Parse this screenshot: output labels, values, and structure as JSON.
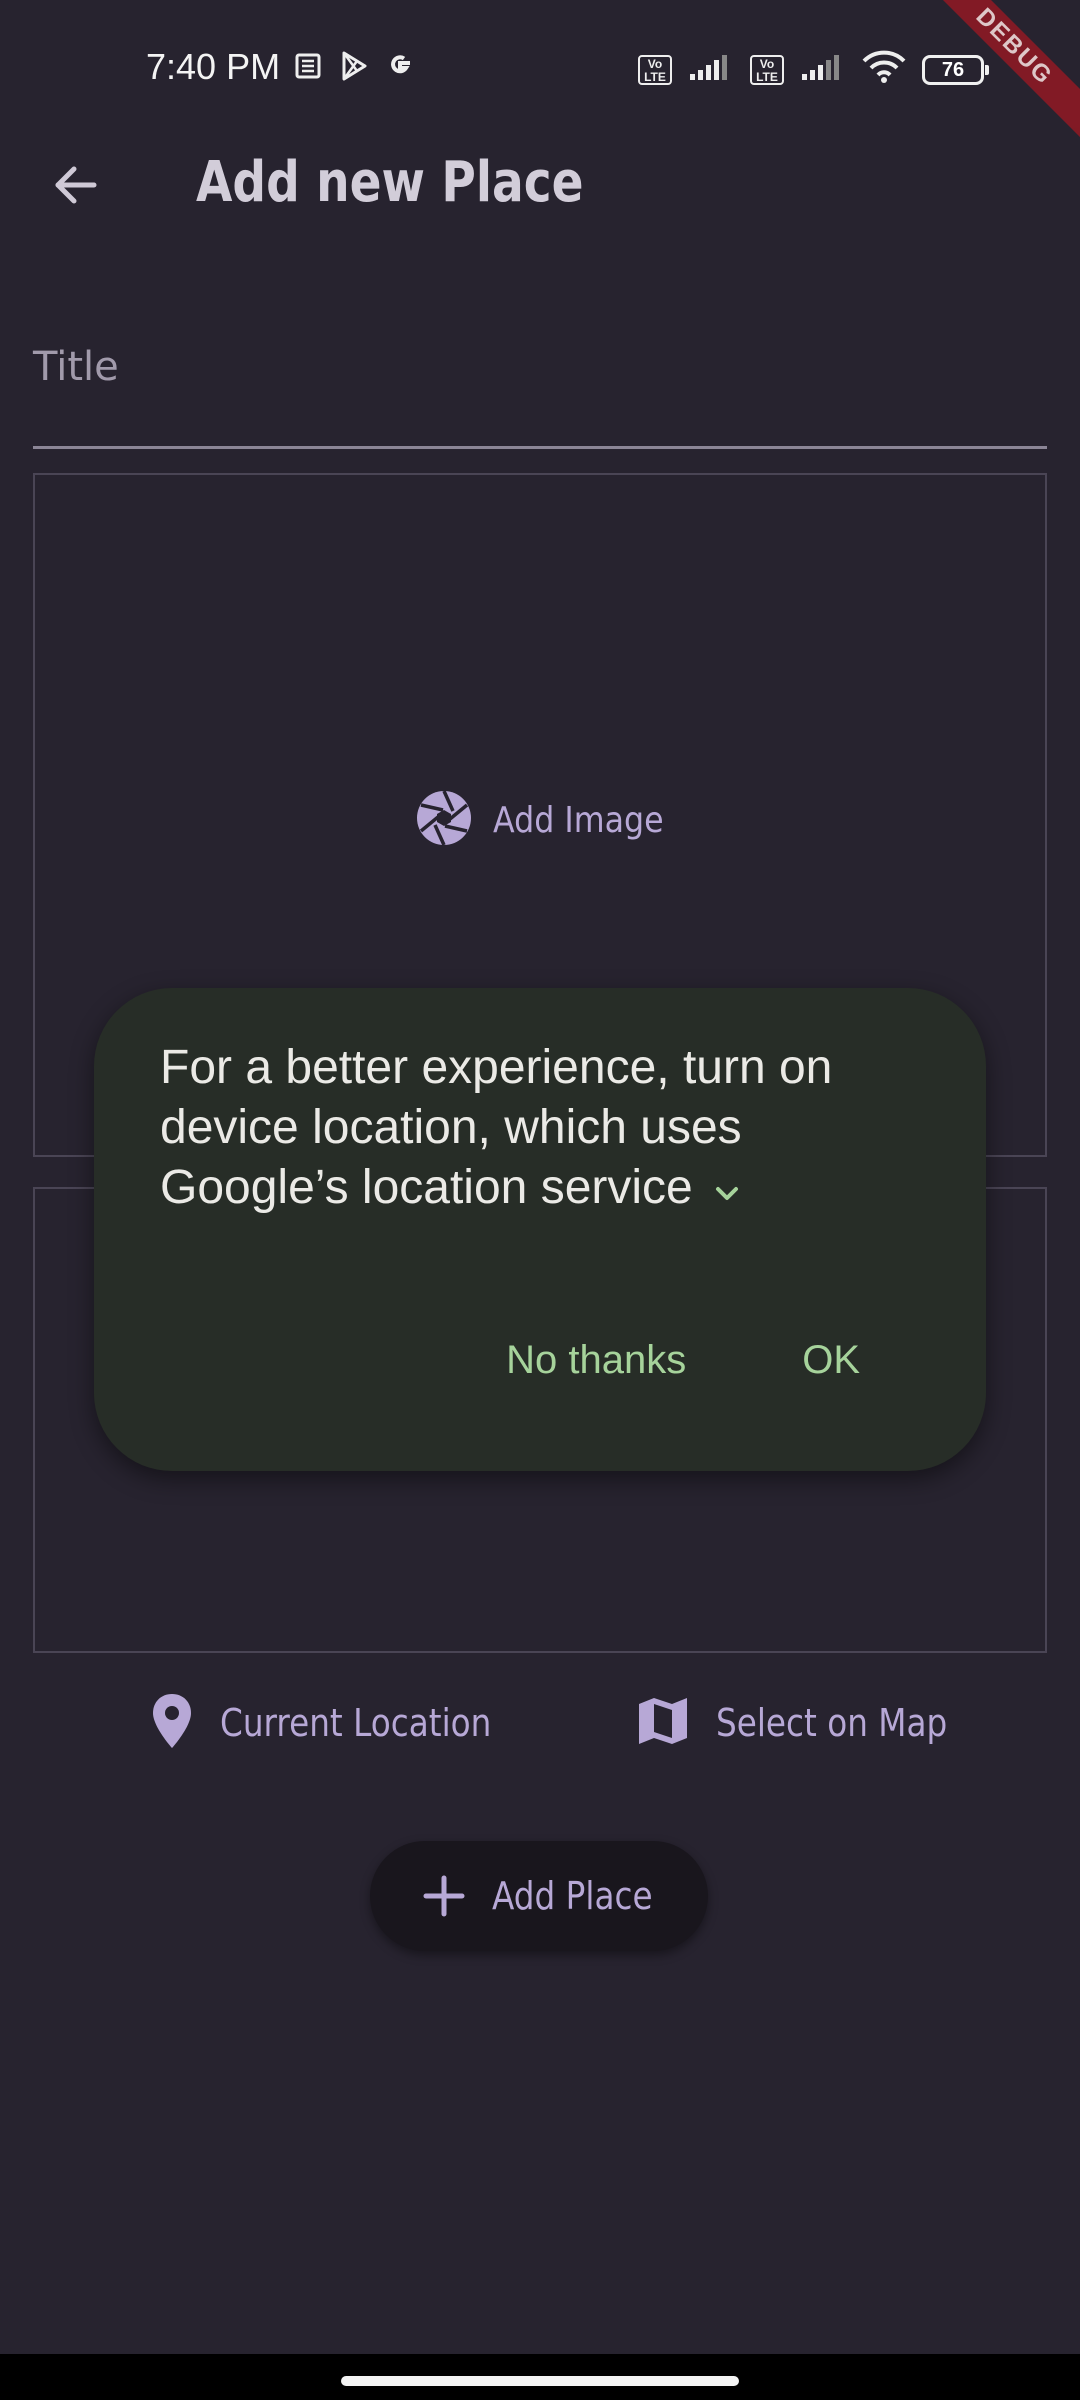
{
  "status_bar": {
    "time": "7:40 PM",
    "volte_label": "Vo LTE",
    "battery": "76",
    "debug_banner": "DEBUG"
  },
  "app_bar": {
    "title": "Add new Place"
  },
  "form": {
    "title_placeholder": "Title",
    "add_image_label": "Add Image",
    "current_location_label": "Current Location",
    "select_on_map_label": "Select on Map",
    "add_place_label": "Add Place"
  },
  "dialog": {
    "message": "For a better experience, turn on device location, which uses Google’s location service",
    "no_thanks_label": "No thanks",
    "ok_label": "OK"
  },
  "colors": {
    "background": "#27232f",
    "accent": "#b7a8d6",
    "dialog_bg": "#272d27",
    "dialog_button": "#a6d39b"
  }
}
